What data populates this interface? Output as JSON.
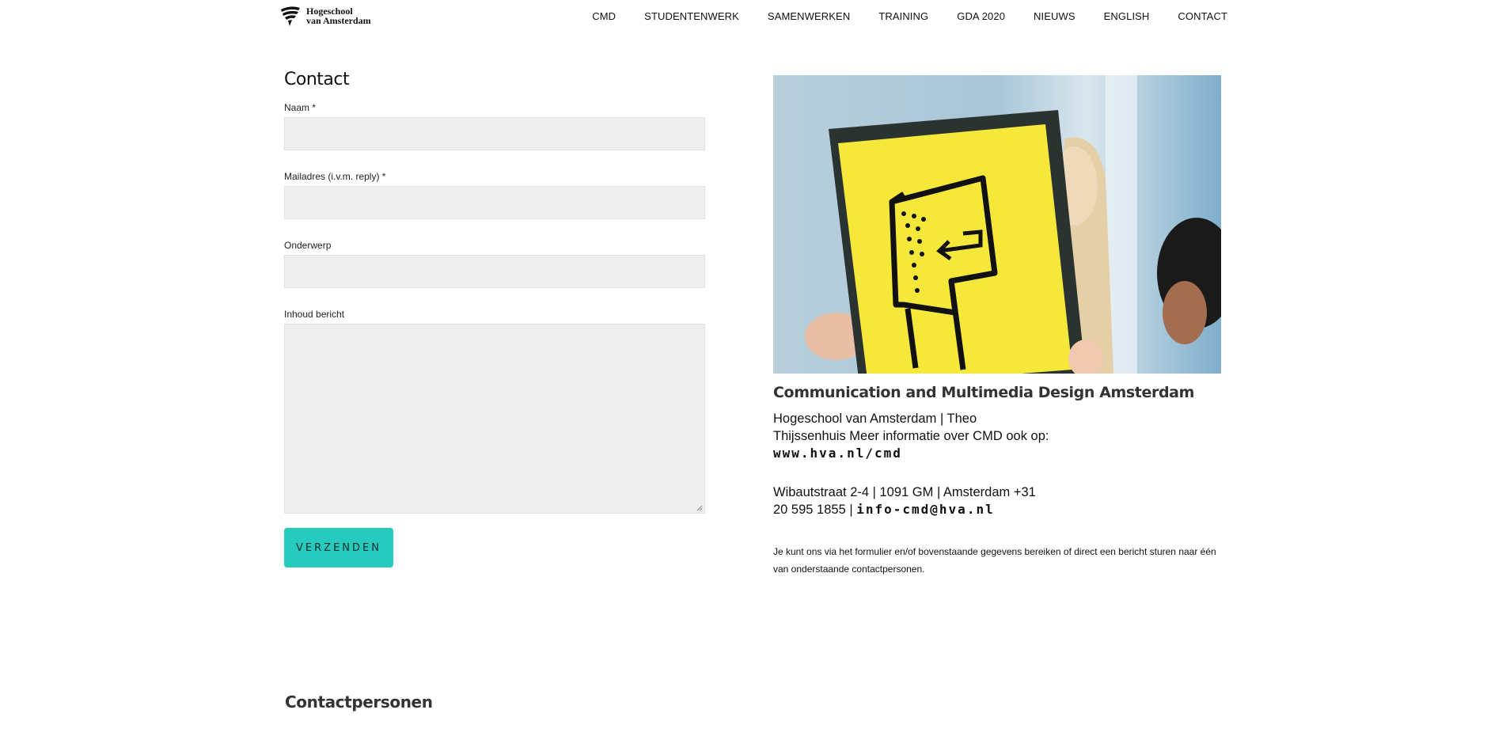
{
  "header": {
    "logo": {
      "line1": "Hogeschool",
      "line2": "van Amsterdam"
    },
    "nav": [
      "CMD",
      "STUDENTENWERK",
      "SAMENWERKEN",
      "TRAINING",
      "GDA 2020",
      "NIEUWS",
      "ENGLISH",
      "CONTACT"
    ]
  },
  "form": {
    "title": "Contact",
    "fields": [
      {
        "label": "Naam *",
        "value": ""
      },
      {
        "label": "Mailadres (i.v.m. reply) *",
        "value": ""
      },
      {
        "label": "Onderwerp",
        "value": ""
      },
      {
        "label": "Inhoud bericht",
        "value": ""
      }
    ],
    "submit_label": "VERZENDEN"
  },
  "info": {
    "title": "Communication and Multimedia Design Amsterdam",
    "address_intro_1": "Hogeschool van Amsterdam | Theo",
    "address_intro_2": "Thijssenhuis Meer informatie over CMD ook op:",
    "website": "www.hva.nl/cmd",
    "street_1": "Wibautstraat 2-4 | 1091 GM | Amsterdam +31",
    "street_2": "20 595 1855 | ",
    "email": "info-cmd@hva.nl",
    "note": "Je kunt ons via het formulier en/of bovenstaande gegevens bereiken of direct een bericht sturen naar één van onderstaande contactpersonen."
  },
  "contacts": {
    "title": "Contactpersonen"
  },
  "colors": {
    "accent": "#27cbbd",
    "input_bg": "#efefef",
    "poster_yellow": "#f5e83a"
  }
}
